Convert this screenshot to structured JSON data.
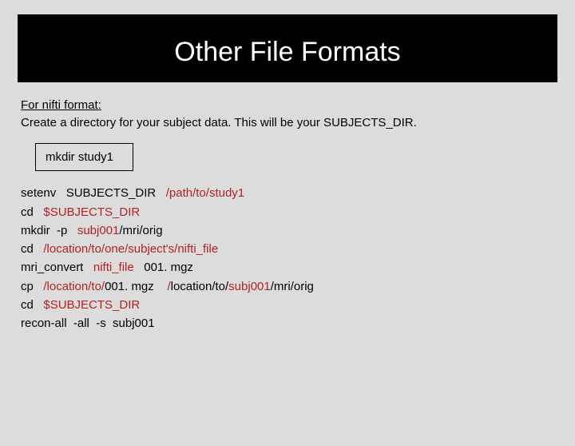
{
  "title": "Other File Formats",
  "intro": {
    "label": "For nifti format:",
    "desc": "Create a directory for your subject data. This will be your SUBJECTS_DIR."
  },
  "box": "mkdir  study1",
  "cmds": {
    "l1a": "setenv   SUBJECTS_DIR   ",
    "l1b": "/path/to/study1",
    "l2a": "cd   ",
    "l2b": "$SUBJECTS_DIR",
    "l3a": "mkdir  -p   ",
    "l3b": "subj001",
    "l3c": "/mri/orig",
    "l4a": "cd   ",
    "l4b": "/location/to/one/subject's/nifti_file",
    "l5a": "mri_convert   ",
    "l5b": "nifti_file",
    "l5c": "   001. mgz",
    "l6a": "cp   ",
    "l6b": "/location/to/",
    "l6c": "001. mgz    ",
    "l6d": "/",
    "l6e": "location/to/",
    "l6f": "subj001",
    "l6g": "/mri/orig",
    "l7a": "cd   ",
    "l7b": "$SUBJECTS_DIR",
    "l8": "recon-all  -all  -s  subj001"
  }
}
